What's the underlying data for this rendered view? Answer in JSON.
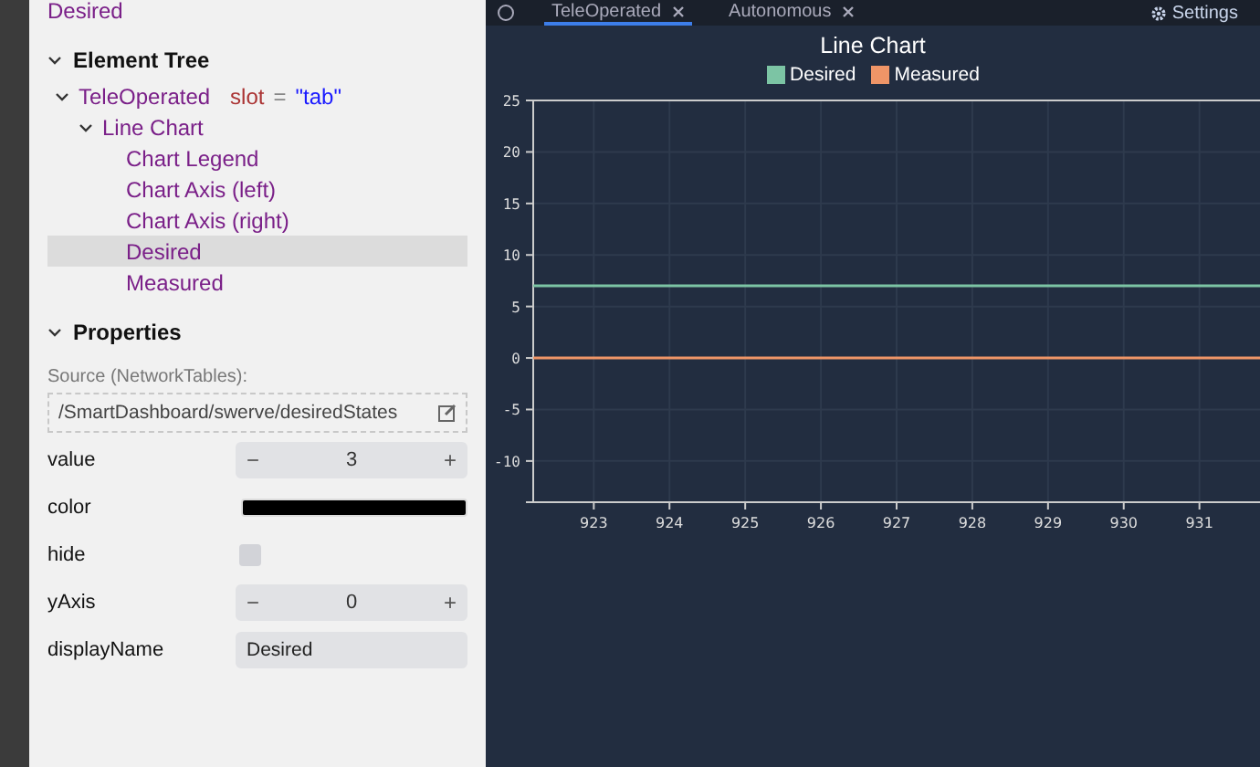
{
  "header": {
    "title": "Desired"
  },
  "element_tree": {
    "title": "Element Tree",
    "expanded": true,
    "items": [
      {
        "label": "TeleOperated",
        "selected": false,
        "expanded": true,
        "attribute": {
          "name": "slot",
          "equals": "=",
          "value": "\"tab\""
        },
        "children": [
          {
            "label": "Line Chart",
            "selected": false,
            "expanded": true,
            "children": [
              {
                "label": "Chart Legend",
                "selected": false
              },
              {
                "label": "Chart Axis (left)",
                "selected": false
              },
              {
                "label": "Chart Axis (right)",
                "selected": false
              },
              {
                "label": "Desired",
                "selected": true
              },
              {
                "label": "Measured",
                "selected": false
              }
            ]
          }
        ]
      }
    ]
  },
  "properties": {
    "title": "Properties",
    "expanded": true,
    "source_label": "Source (NetworkTables):",
    "source_path": "/SmartDashboard/swerve/desiredStates",
    "rows": [
      {
        "kind": "stepper",
        "label": "value",
        "value": "3",
        "minus": "−",
        "plus": "+"
      },
      {
        "kind": "color",
        "label": "color",
        "color": "#000000"
      },
      {
        "kind": "checkbox",
        "label": "hide",
        "checked": false
      },
      {
        "kind": "stepper",
        "label": "yAxis",
        "value": "0",
        "minus": "−",
        "plus": "+"
      },
      {
        "kind": "text",
        "label": "displayName",
        "value": "Desired"
      }
    ]
  },
  "tabs": [
    {
      "label": "TeleOperated",
      "selected": true
    },
    {
      "label": "Autonomous",
      "selected": false
    }
  ],
  "settings": {
    "label": "Settings"
  },
  "chart": {
    "chart_data": {
      "type": "line",
      "title": "Line Chart",
      "x": [
        922.2,
        931.8
      ],
      "series": [
        {
          "name": "Desired",
          "color": "#7cc4a4",
          "values": [
            7,
            7
          ]
        },
        {
          "name": "Measured",
          "color": "#ef9567",
          "values": [
            0,
            0
          ]
        }
      ],
      "grid": true,
      "xlim": [
        922.2,
        931.8
      ],
      "ylim": [
        -14,
        25
      ],
      "xticks": [
        923,
        924,
        925,
        926,
        927,
        928,
        929,
        930,
        931
      ],
      "yticks": [
        -10,
        -5,
        0,
        5,
        10,
        15,
        20,
        25
      ]
    }
  }
}
